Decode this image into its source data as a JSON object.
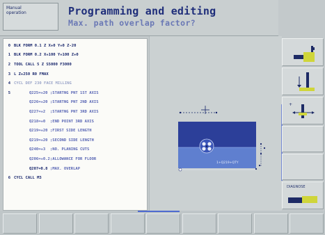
{
  "header": {
    "mode_line1": "Manual",
    "mode_line2": "operation",
    "title": "Programming and editing",
    "subtitle": "Max. path overlap factor?"
  },
  "program": {
    "lines": [
      {
        "n": "0",
        "code": "BLK FORM 0.1 Z  X+0  Y+0  Z-20",
        "kind": "normal"
      },
      {
        "n": "1",
        "code": "BLK FORM 0.2  X+100  Y+100  Z+0",
        "kind": "normal"
      },
      {
        "n": "2",
        "code": "TOOL CALL 5 Z S5000 F3000",
        "kind": "normal"
      },
      {
        "n": "3",
        "code": "L  Z+250 R0 FMAX",
        "kind": "normal"
      },
      {
        "n": "4",
        "code": "CYCL DEF 230 FACE MILLING",
        "kind": "hl"
      },
      {
        "n": "5",
        "p1": "Q225=+20",
        "p2": ";STARTNG PNT 1ST AXIS",
        "kind": "param"
      },
      {
        "n": "",
        "p1": "Q226=+20",
        "p2": ";STARTNG PNT 2ND AXIS",
        "kind": "param"
      },
      {
        "n": "",
        "p1": "Q227=+2",
        "p2": ";STARTNG PNT 3RD AXIS",
        "kind": "param"
      },
      {
        "n": "",
        "p1": "Q218=+0",
        "p2": ";END POINT 3RD AXIS",
        "kind": "param"
      },
      {
        "n": "",
        "p1": "Q219=+20",
        "p2": ";FIRST SIDE LENGTH",
        "kind": "param"
      },
      {
        "n": "",
        "p1": "Q219=+20",
        "p2": ";SECOND SIDE LENGTH",
        "kind": "param"
      },
      {
        "n": "",
        "p1": "Q240=+3",
        "p2": ";NO. PLANING CUTS",
        "kind": "param"
      },
      {
        "n": "",
        "p1": "Q206=+0.2",
        "p2": ";ALLOWANCE FOR FLOOR",
        "kind": "param"
      },
      {
        "n": "",
        "p1": "Q207=0.8",
        "p2": ";MAX. OVERLAP",
        "kind": "cur"
      },
      {
        "n": "6",
        "code": "CYCL CALL M3",
        "kind": "normal"
      }
    ]
  },
  "graphic": {
    "annotation": "1+Q219+QTY"
  },
  "softkeys_right": [
    {
      "label": "",
      "icon": "tool-holder-icon"
    },
    {
      "label": "",
      "icon": "depth-arrow-icon"
    },
    {
      "label": "",
      "icon": "axis-arrows-icon"
    },
    {
      "label": "",
      "icon": ""
    },
    {
      "label": "",
      "icon": ""
    },
    {
      "label": "DIAGNOSE",
      "icon": "diagnose-icon"
    }
  ],
  "softkeys_bottom": [
    "",
    "",
    "",
    "",
    "",
    "",
    "",
    "",
    ""
  ],
  "colors": {
    "plate_dark": "#2c3f99",
    "plate_light": "#5f7fcf",
    "accent": "#4e6ad0",
    "text_dark": "#15236a"
  }
}
